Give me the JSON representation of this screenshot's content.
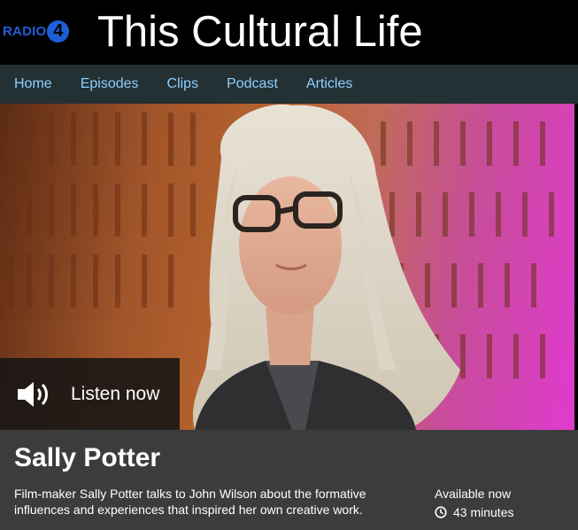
{
  "brand": {
    "logo_text": "RADIO",
    "logo_number": "4",
    "logo_color": "#1f5fd6"
  },
  "page_title": "This Cultural Life",
  "nav": {
    "items": [
      {
        "label": "Home"
      },
      {
        "label": "Episodes"
      },
      {
        "label": "Clips"
      },
      {
        "label": "Podcast"
      },
      {
        "label": "Articles"
      }
    ],
    "link_color": "#8fd0ff"
  },
  "hero": {
    "listen_label": "Listen now",
    "icon": "speaker-icon"
  },
  "episode": {
    "name": "Sally Potter",
    "description": "Film-maker Sally Potter talks to John Wilson about the formative influences and experiences that inspired her own creative work.",
    "availability": "Available now",
    "duration": "43 minutes",
    "duration_icon": "clock-icon"
  }
}
